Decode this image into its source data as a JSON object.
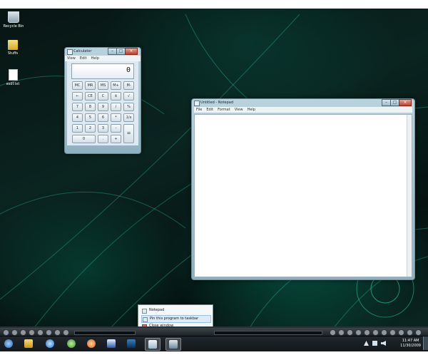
{
  "desktop_icons": [
    {
      "label": "Recycle Bin"
    },
    {
      "label": "Stuffs"
    },
    {
      "label": "asdf.txt"
    }
  ],
  "calculator": {
    "title": "Calculator",
    "menu": [
      "View",
      "Edit",
      "Help"
    ],
    "display": "0",
    "keys": [
      "MC",
      "MR",
      "MS",
      "M+",
      "M-",
      "←",
      "CE",
      "C",
      "±",
      "√",
      "7",
      "8",
      "9",
      "/",
      "%",
      "4",
      "5",
      "6",
      "*",
      "1/x",
      "1",
      "2",
      "3",
      "-",
      "=",
      "0",
      ".",
      "+"
    ]
  },
  "notepad": {
    "title": "Untitled - Notepad",
    "menu": [
      "File",
      "Edit",
      "Format",
      "View",
      "Help"
    ]
  },
  "jumplist": {
    "items": [
      "Notepad",
      "Pin this program to taskbar",
      "Close window"
    ]
  },
  "clock": {
    "time": "11:47 AM",
    "date": "11/30/2009"
  },
  "colors": {
    "accent": "#1de9b6",
    "taskbar": "#1a2024"
  }
}
